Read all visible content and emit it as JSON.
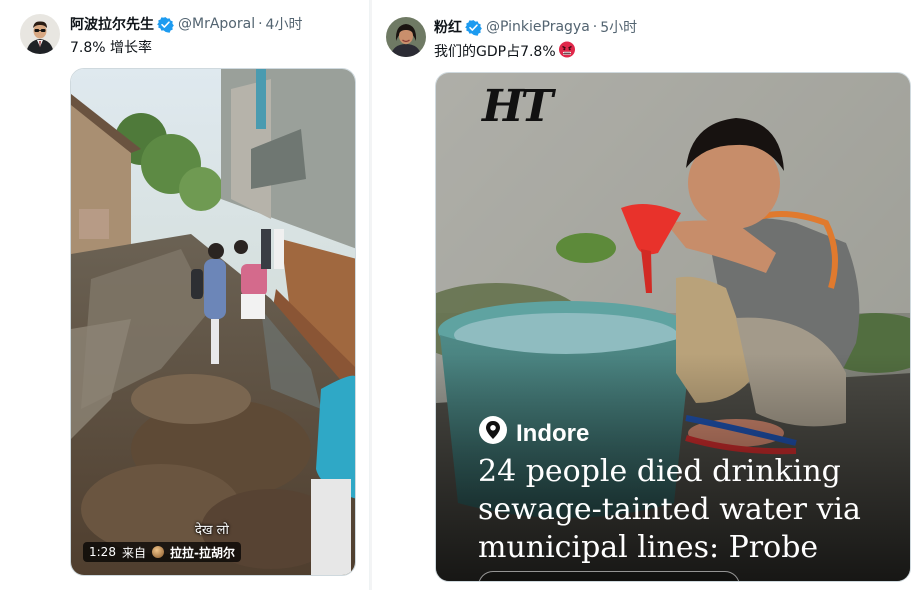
{
  "tweets": [
    {
      "display_name": "阿波拉尔先生",
      "handle": "@MrAporal",
      "separator": "·",
      "time": "4小时",
      "text": "7.8% 增长率",
      "media": {
        "type": "video",
        "caption": "देख लो",
        "duration": "1:28",
        "source_prefix": "来自",
        "source_name": "拉拉-拉胡尔"
      }
    },
    {
      "display_name": "粉红",
      "handle": "@PinkiePragya",
      "separator": "·",
      "time": "5小时",
      "text": "我们的GDP占7.8%",
      "media": {
        "type": "news-card",
        "publisher_logo": "HT",
        "location": "Indore",
        "headline": "24 people died drinking sewage-tainted water via municipal lines: Probe"
      }
    }
  ],
  "colors": {
    "verified_blue": "#1d9bf0",
    "secondary_text": "#536471",
    "primary_text": "#0f1419"
  },
  "icons": {
    "verified": "verified-badge-icon",
    "location": "map-pin-icon",
    "angry_emoji": "angry-face-emoji-icon"
  }
}
